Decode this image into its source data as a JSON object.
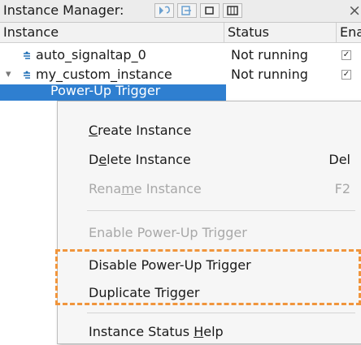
{
  "window": {
    "title": "Instance Manager:",
    "close_glyph": "×",
    "toolbar_icons": [
      "run-icon",
      "stop-icon",
      "autorun-icon",
      "settings-icon"
    ]
  },
  "columns": {
    "instance": "Instance",
    "status": "Status",
    "enable": "Ena"
  },
  "rows": [
    {
      "expander": "",
      "name": "auto_signaltap_0",
      "status": "Not running",
      "enabled": "✓"
    },
    {
      "expander": "▾",
      "name": "my_custom_instance",
      "status": "Not running",
      "enabled": "✓"
    },
    {
      "name": "Power-Up Trigger"
    }
  ],
  "context_menu": {
    "create": {
      "pre": "",
      "mnemonic": "C",
      "post": "reate Instance"
    },
    "delete": {
      "pre": "D",
      "mnemonic": "e",
      "post": "lete Instance",
      "shortcut": "Del"
    },
    "rename": {
      "pre": "Rena",
      "mnemonic": "m",
      "post": "e Instance",
      "shortcut": "F2"
    },
    "enable_power_up": "Enable Power-Up Trigger",
    "disable_power_up": "Disable Power-Up Trigger",
    "duplicate_trigger": "Duplicate Trigger",
    "status_help": {
      "pre": "Instance Status ",
      "mnemonic": "H",
      "post": "elp"
    }
  },
  "colors": {
    "selection": "#2f7fd0",
    "highlight_box": "#f0953c",
    "instance_icon": "#1f6fb5",
    "disabled_text": "#a8a8a8"
  }
}
